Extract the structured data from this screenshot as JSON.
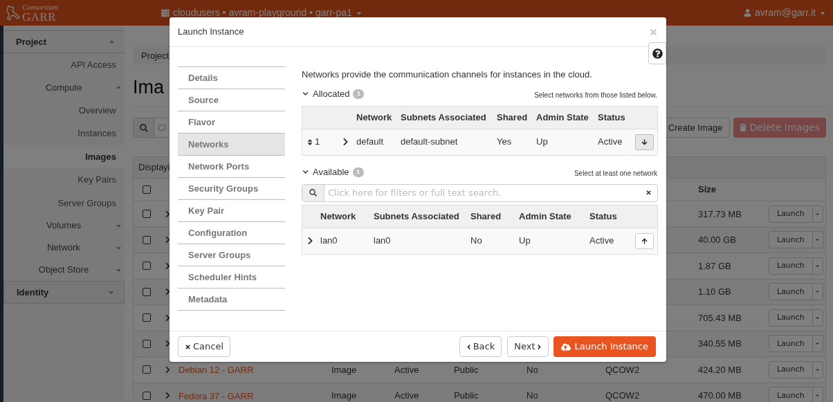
{
  "header": {
    "logo_top": "Consortium",
    "logo_main": "GARR",
    "project_selector": "cloudusers • avram-playground • garr-pa1",
    "user": "avram@garr.it"
  },
  "sidebar": [
    {
      "label": "Project",
      "expanded": true,
      "children": [
        {
          "label": "API Access",
          "selected": false
        },
        {
          "label": "Compute",
          "expanded": true,
          "children": [
            {
              "label": "Overview",
              "selected": false
            },
            {
              "label": "Instances",
              "selected": false
            },
            {
              "label": "Images",
              "selected": true
            },
            {
              "label": "Key Pairs",
              "selected": false
            },
            {
              "label": "Server Groups",
              "selected": false
            }
          ]
        },
        {
          "label": "Volumes",
          "expanded": false
        },
        {
          "label": "Network",
          "expanded": false
        },
        {
          "label": "Object Store",
          "expanded": false
        }
      ]
    },
    {
      "label": "Identity",
      "expanded": false
    }
  ],
  "page": {
    "breadcrumb": "Project",
    "title": "Ima",
    "search_placeholder": "Cl",
    "create_button": "Create Image",
    "delete_button": "Delete Images",
    "table": {
      "caption": "Displayi",
      "select_all": false,
      "size_column": "Size",
      "rows": [
        {
          "checked": false,
          "size": "317.73 MB",
          "launch": "Launch"
        },
        {
          "checked": false,
          "size": "40.00 GB",
          "launch": "Launch"
        },
        {
          "checked": false,
          "size": "1.87 GB",
          "launch": "Launch"
        },
        {
          "checked": false,
          "size": "1.10 GB",
          "launch": "Launch"
        },
        {
          "checked": false,
          "size": "705.43 MB",
          "launch": "Launch"
        },
        {
          "checked": false,
          "size": "340.55 MB",
          "launch": "Launch"
        },
        {
          "checked": false,
          "name": "Debian 12 - GARR",
          "type": "Image",
          "status": "Active",
          "visibility": "Public",
          "protected": "No",
          "format": "QCOW2",
          "size": "424.20 MB",
          "launch": "Launch"
        },
        {
          "checked": false,
          "name": "Fedora 37 - GARR",
          "type": "Image",
          "status": "Active",
          "visibility": "Public",
          "protected": "No",
          "format": "QCOW2",
          "size": "470.00 MB",
          "launch": "Launch"
        }
      ]
    }
  },
  "modal": {
    "title": "Launch Instance",
    "steps": [
      {
        "label": "Details",
        "selected": false
      },
      {
        "label": "Source",
        "selected": false
      },
      {
        "label": "Flavor",
        "selected": false
      },
      {
        "label": "Networks",
        "selected": true
      },
      {
        "label": "Network Ports",
        "selected": false
      },
      {
        "label": "Security Groups",
        "selected": false
      },
      {
        "label": "Key Pair",
        "selected": false
      },
      {
        "label": "Configuration",
        "selected": false
      },
      {
        "label": "Server Groups",
        "selected": false
      },
      {
        "label": "Scheduler Hints",
        "selected": false
      },
      {
        "label": "Metadata",
        "selected": false
      }
    ],
    "intro": "Networks provide the communication channels for instances in the cloud.",
    "allocated": {
      "label": "Allocated",
      "count": "1",
      "hint": "Select networks from those listed below.",
      "columns": [
        "Network",
        "Subnets Associated",
        "Shared",
        "Admin State",
        "Status"
      ],
      "rows": [
        {
          "order": "1",
          "network": "default",
          "subnets": "default-subnet",
          "shared": "Yes",
          "admin_state": "Up",
          "status": "Active"
        }
      ]
    },
    "available": {
      "label": "Available",
      "count": "1",
      "hint": "Select at least one network",
      "search_placeholder": "Click here for filters or full text search.",
      "columns": [
        "Network",
        "Subnets Associated",
        "Shared",
        "Admin State",
        "Status"
      ],
      "rows": [
        {
          "network": "lan0",
          "subnets": "lan0",
          "shared": "No",
          "admin_state": "Up",
          "status": "Active"
        }
      ]
    },
    "buttons": {
      "cancel": "Cancel",
      "back": "Back",
      "next": "Next",
      "launch": "Launch Instance"
    }
  }
}
